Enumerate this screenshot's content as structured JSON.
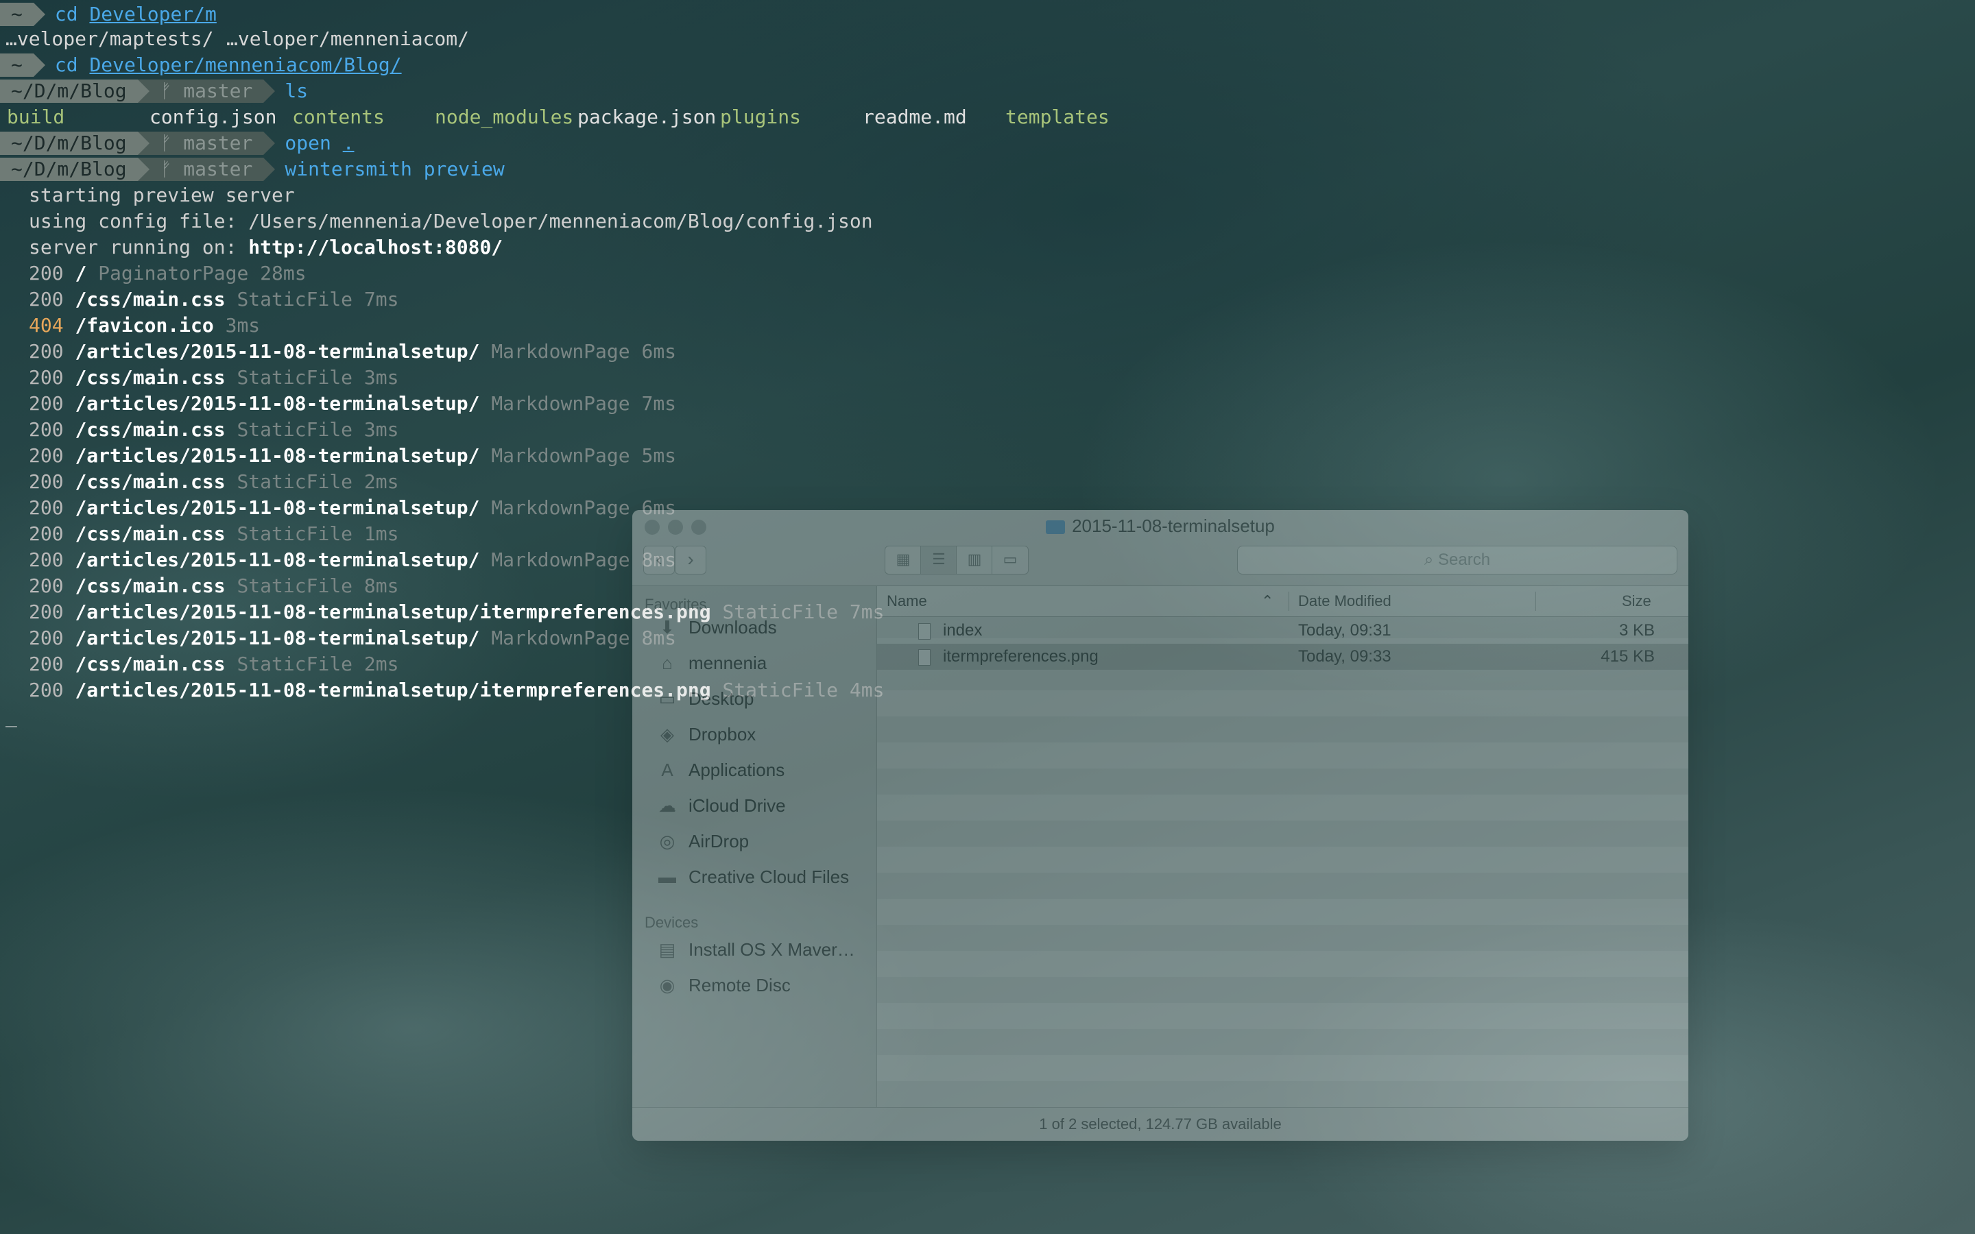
{
  "terminal": {
    "prompt_home": "~",
    "cmd_cd": "cd",
    "cd1_arg": "Developer/m",
    "completion1": "…veloper/maptests/",
    "completion2": "…veloper/menneniacom/",
    "cd2_arg": "Developer/menneniacom/Blog/",
    "prompt_dir": "~/D/m/Blog",
    "prompt_branch": "ᚠ master",
    "cmd_ls": "ls",
    "ls_items": [
      "build",
      "config.json",
      "contents",
      "node_modules",
      "package.json",
      "plugins",
      "readme.md",
      "templates"
    ],
    "cmd_open": "open",
    "open_arg": ".",
    "cmd_ws": "wintersmith",
    "cmd_preview": "preview",
    "msg_starting": "starting preview server",
    "msg_config": "using config file: /Users/mennenia/Developer/menneniacom/Blog/config.json",
    "msg_server_prefix": "server running on: ",
    "msg_server_url": "http://localhost:8080/",
    "log": [
      {
        "code": "200",
        "path": "/",
        "type": "PaginatorPage 28ms"
      },
      {
        "code": "200",
        "path": "/css/main.css",
        "type": "StaticFile 7ms"
      },
      {
        "code": "404",
        "path": "/favicon.ico",
        "type": "3ms"
      },
      {
        "code": "200",
        "path": "/articles/2015-11-08-terminalsetup/",
        "type": "MarkdownPage 6ms"
      },
      {
        "code": "200",
        "path": "/css/main.css",
        "type": "StaticFile 3ms"
      },
      {
        "code": "200",
        "path": "/articles/2015-11-08-terminalsetup/",
        "type": "MarkdownPage 7ms"
      },
      {
        "code": "200",
        "path": "/css/main.css",
        "type": "StaticFile 3ms"
      },
      {
        "code": "200",
        "path": "/articles/2015-11-08-terminalsetup/",
        "type": "MarkdownPage 5ms"
      },
      {
        "code": "200",
        "path": "/css/main.css",
        "type": "StaticFile 2ms"
      },
      {
        "code": "200",
        "path": "/articles/2015-11-08-terminalsetup/",
        "type": "MarkdownPage 6ms"
      },
      {
        "code": "200",
        "path": "/css/main.css",
        "type": "StaticFile 1ms"
      },
      {
        "code": "200",
        "path": "/articles/2015-11-08-terminalsetup/",
        "type": "MarkdownPage 8ms"
      },
      {
        "code": "200",
        "path": "/css/main.css",
        "type": "StaticFile 8ms"
      },
      {
        "code": "200",
        "path": "/articles/2015-11-08-terminalsetup/itermpreferences.png",
        "type": "StaticFile 7ms"
      },
      {
        "code": "200",
        "path": "/articles/2015-11-08-terminalsetup/",
        "type": "MarkdownPage 8ms"
      },
      {
        "code": "200",
        "path": "/css/main.css",
        "type": "StaticFile 2ms"
      },
      {
        "code": "200",
        "path": "/articles/2015-11-08-terminalsetup/itermpreferences.png",
        "type": "StaticFile 4ms"
      }
    ],
    "cursor": "_"
  },
  "finder": {
    "title": "2015-11-08-terminalsetup",
    "search_placeholder": "Search",
    "sidebar": {
      "favorites_heading": "Favorites",
      "favorites": [
        {
          "label": "Downloads",
          "icon": "download-icon"
        },
        {
          "label": "mennenia",
          "icon": "home-icon"
        },
        {
          "label": "Desktop",
          "icon": "desktop-icon"
        },
        {
          "label": "Dropbox",
          "icon": "dropbox-icon"
        },
        {
          "label": "Applications",
          "icon": "applications-icon"
        },
        {
          "label": "iCloud Drive",
          "icon": "cloud-icon"
        },
        {
          "label": "AirDrop",
          "icon": "airdrop-icon"
        },
        {
          "label": "Creative Cloud Files",
          "icon": "folder-icon"
        }
      ],
      "devices_heading": "Devices",
      "devices": [
        {
          "label": "Install OS X Maver…",
          "icon": "disk-icon"
        },
        {
          "label": "Remote Disc",
          "icon": "disc-icon"
        }
      ]
    },
    "columns": {
      "name": "Name",
      "date": "Date Modified",
      "size": "Size"
    },
    "files": [
      {
        "name": "index",
        "date": "Today, 09:31",
        "size": "3 KB",
        "selected": false
      },
      {
        "name": "itermpreferences.png",
        "date": "Today, 09:33",
        "size": "415 KB",
        "selected": true
      }
    ],
    "status": "1 of 2 selected, 124.77 GB available"
  }
}
